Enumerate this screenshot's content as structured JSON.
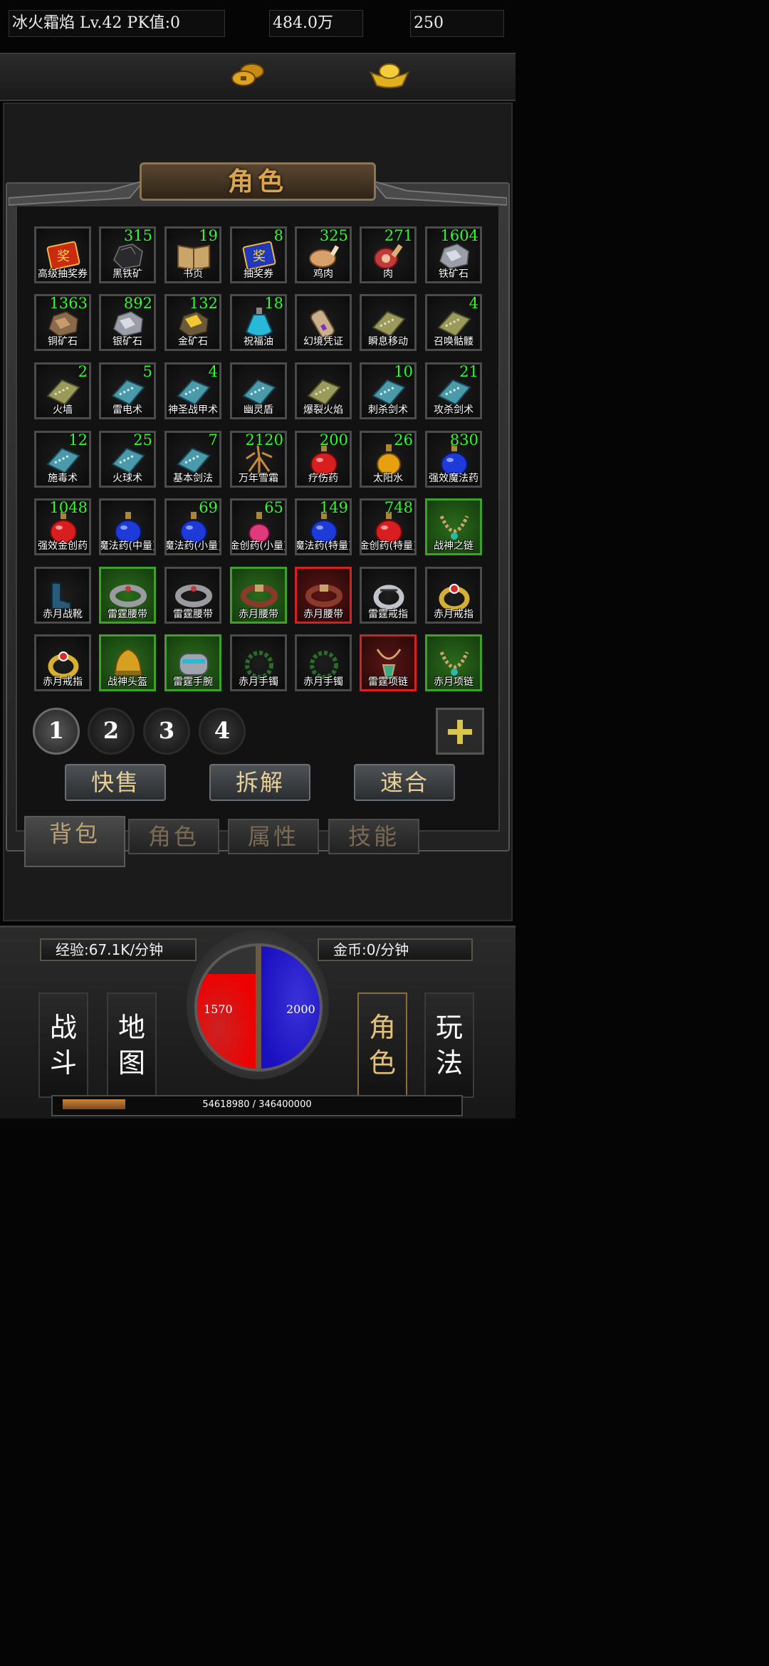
{
  "header": {
    "player": "冰火霜焰  Lv.42 PK值:0",
    "gold": "484.0万",
    "ingot": "250"
  },
  "panel": {
    "title": "角色"
  },
  "inventory": [
    {
      "name": "高级抽奖券",
      "count": "",
      "icon": "ticket-red",
      "frame": "normal"
    },
    {
      "name": "黑铁矿",
      "count": "315",
      "icon": "ore-black",
      "frame": "normal"
    },
    {
      "name": "书页",
      "count": "19",
      "icon": "book",
      "frame": "normal"
    },
    {
      "name": "抽奖券",
      "count": "8",
      "icon": "ticket-blue",
      "frame": "normal"
    },
    {
      "name": "鸡肉",
      "count": "325",
      "icon": "chicken",
      "frame": "normal"
    },
    {
      "name": "肉",
      "count": "271",
      "icon": "meat",
      "frame": "normal"
    },
    {
      "name": "铁矿石",
      "count": "1604",
      "icon": "ore-silver",
      "frame": "normal"
    },
    {
      "name": "铜矿石",
      "count": "1363",
      "icon": "ore-copper",
      "frame": "normal"
    },
    {
      "name": "银矿石",
      "count": "892",
      "icon": "ore-silver",
      "frame": "normal"
    },
    {
      "name": "金矿石",
      "count": "132",
      "icon": "ore-gold",
      "frame": "normal"
    },
    {
      "name": "祝福油",
      "count": "18",
      "icon": "potion-cyan",
      "frame": "normal"
    },
    {
      "name": "幻境凭证",
      "count": "",
      "icon": "scroll",
      "frame": "normal"
    },
    {
      "name": "瞬息移动",
      "count": "",
      "icon": "skillbook-olive",
      "frame": "normal"
    },
    {
      "name": "召唤骷髅",
      "count": "4",
      "icon": "skillbook-olive",
      "frame": "normal"
    },
    {
      "name": "火墙",
      "count": "2",
      "icon": "skillbook-olive",
      "frame": "normal"
    },
    {
      "name": "雷电术",
      "count": "5",
      "icon": "skillbook-blue",
      "frame": "normal"
    },
    {
      "name": "神圣战甲术",
      "count": "4",
      "icon": "skillbook-blue",
      "frame": "normal"
    },
    {
      "name": "幽灵盾",
      "count": "",
      "icon": "skillbook-blue",
      "frame": "normal"
    },
    {
      "name": "爆裂火焰",
      "count": "",
      "icon": "skillbook-olive",
      "frame": "normal"
    },
    {
      "name": "刺杀剑术",
      "count": "10",
      "icon": "skillbook-blue",
      "frame": "normal"
    },
    {
      "name": "攻杀剑术",
      "count": "21",
      "icon": "skillbook-blue",
      "frame": "normal"
    },
    {
      "name": "施毒术",
      "count": "12",
      "icon": "skillbook-blue",
      "frame": "normal"
    },
    {
      "name": "火球术",
      "count": "25",
      "icon": "skillbook-blue",
      "frame": "normal"
    },
    {
      "name": "基本剑法",
      "count": "7",
      "icon": "skillbook-blue",
      "frame": "normal"
    },
    {
      "name": "万年雪霜",
      "count": "2120",
      "icon": "ginseng",
      "frame": "normal"
    },
    {
      "name": "疗伤药",
      "count": "200",
      "icon": "potion-red",
      "frame": "normal"
    },
    {
      "name": "太阳水",
      "count": "26",
      "icon": "potion-gold",
      "frame": "normal"
    },
    {
      "name": "强效魔法药",
      "count": "830",
      "icon": "potion-blue",
      "frame": "normal"
    },
    {
      "name": "强效金创药",
      "count": "1048",
      "icon": "potion-red",
      "frame": "normal"
    },
    {
      "name": "魔法药(中量)",
      "count": "",
      "icon": "potion-blue",
      "frame": "normal"
    },
    {
      "name": "魔法药(小量)",
      "count": "69",
      "icon": "potion-blue",
      "frame": "normal"
    },
    {
      "name": "金创药(小量)",
      "count": "65",
      "icon": "potion-pink",
      "frame": "normal"
    },
    {
      "name": "魔法药(特量)",
      "count": "149",
      "icon": "potion-blue",
      "frame": "normal"
    },
    {
      "name": "金创药(特量)",
      "count": "748",
      "icon": "potion-red",
      "frame": "normal"
    },
    {
      "name": "战神之链",
      "count": "",
      "icon": "necklace",
      "frame": "green"
    },
    {
      "name": "赤月战靴",
      "count": "",
      "icon": "boots",
      "frame": "normal"
    },
    {
      "name": "雷霆腰带",
      "count": "",
      "icon": "belt",
      "frame": "green"
    },
    {
      "name": "雷霆腰带",
      "count": "",
      "icon": "belt",
      "frame": "normal"
    },
    {
      "name": "赤月腰带",
      "count": "",
      "icon": "belt-red",
      "frame": "green"
    },
    {
      "name": "赤月腰带",
      "count": "",
      "icon": "belt-red",
      "frame": "red"
    },
    {
      "name": "雷霆戒指",
      "count": "",
      "icon": "ring-silver",
      "frame": "normal"
    },
    {
      "name": "赤月戒指",
      "count": "",
      "icon": "ring-gold",
      "frame": "normal"
    },
    {
      "name": "赤月戒指",
      "count": "",
      "icon": "ring-gold",
      "frame": "normal"
    },
    {
      "name": "战神头盔",
      "count": "",
      "icon": "helmet",
      "frame": "green"
    },
    {
      "name": "雷霆手腕",
      "count": "",
      "icon": "bracer",
      "frame": "green"
    },
    {
      "name": "赤月手镯",
      "count": "",
      "icon": "bracelet",
      "frame": "normal"
    },
    {
      "name": "赤月手镯",
      "count": "",
      "icon": "bracelet",
      "frame": "normal"
    },
    {
      "name": "雷霆项链",
      "count": "",
      "icon": "amulet",
      "frame": "red"
    },
    {
      "name": "赤月项链",
      "count": "",
      "icon": "necklace",
      "frame": "green"
    }
  ],
  "pages": [
    "1",
    "2",
    "3",
    "4"
  ],
  "actions": [
    "快售",
    "拆解",
    "速合"
  ],
  "tabs": [
    "背包",
    "角色",
    "属性",
    "技能"
  ],
  "hud": {
    "exp_rate": "经验:67.1K/分钟",
    "gold_rate": "金币:0/分钟",
    "hp": "1570",
    "mp": "2000",
    "left_buttons": [
      "战\n斗",
      "地\n图"
    ],
    "right_buttons": [
      "角\n色",
      "玩\n法"
    ],
    "exp_text": "54618980 / 346400000",
    "exp_fraction": 0.158
  }
}
